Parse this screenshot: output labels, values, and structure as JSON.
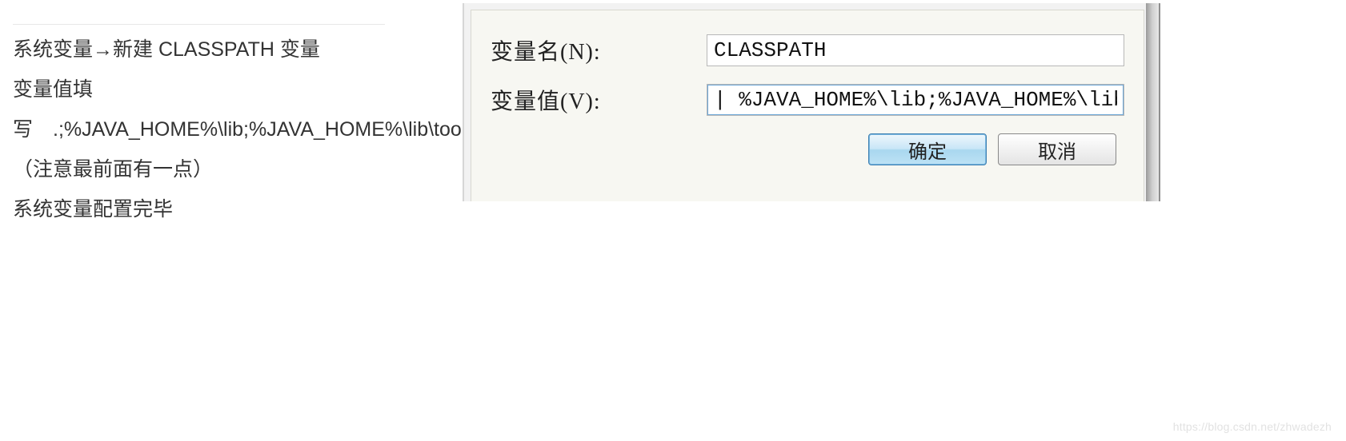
{
  "left_text": {
    "line1": "系统变量→新建 CLASSPATH 变量",
    "line2": "变量值填写　.;%JAVA_HOME%\\lib;%JAVA_HOME%\\lib\\tools.jar（注意最前面有一点）",
    "line3": "系统变量配置完毕"
  },
  "dialog": {
    "name_label": "变量名(N):",
    "value_label": "变量值(V):",
    "name_value": "CLASSPATH",
    "value_value": "| %JAVA_HOME%\\lib;%JAVA_HOME%\\lib\\to",
    "ok": "确定",
    "cancel": "取消"
  },
  "watermark": "https://blog.csdn.net/zhwadezh"
}
